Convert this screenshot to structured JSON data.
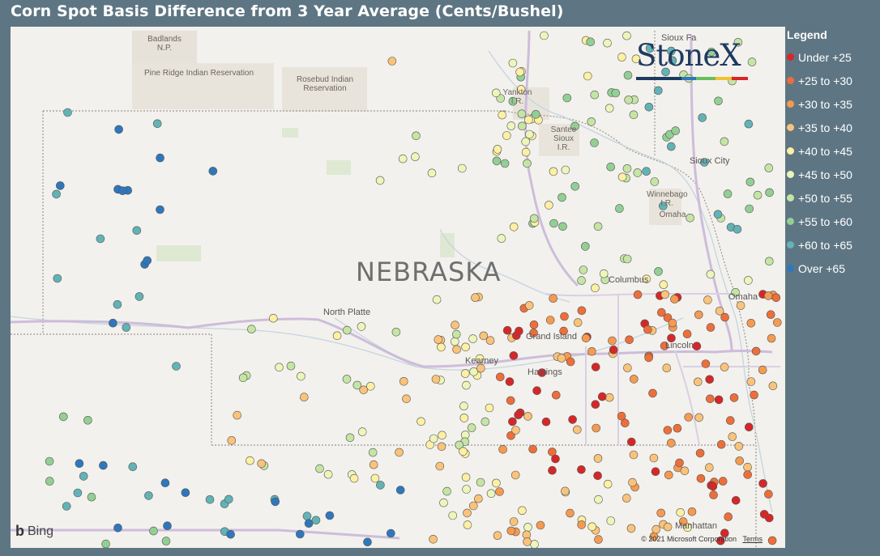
{
  "title": "Corn Spot Basis Difference from 3 Year Average (Cents/Bushel)",
  "legend": {
    "title": "Legend",
    "items": [
      {
        "label": "Under +25",
        "color": "#d62728"
      },
      {
        "label": "+25 to +30",
        "color": "#ee6e3a"
      },
      {
        "label": "+30 to +35",
        "color": "#f59a50"
      },
      {
        "label": "+35 to +40",
        "color": "#fac37a"
      },
      {
        "label": "+40 to +45",
        "color": "#fdf0a3"
      },
      {
        "label": "+45 to +50",
        "color": "#ecf6bb"
      },
      {
        "label": "+50 to +55",
        "color": "#c4e5a4"
      },
      {
        "label": "+55 to +60",
        "color": "#92cf94"
      },
      {
        "label": "+60 to +65",
        "color": "#62b3b6"
      },
      {
        "label": "Over +65",
        "color": "#2f77bd"
      }
    ]
  },
  "map": {
    "state_label": "NEBRASKA",
    "places": {
      "badlands": "Badlands\nN.P.",
      "pine_ridge": "Pine Ridge Indian Reservation",
      "rosebud": "Rosebud Indian\nReservation",
      "yankton": "Yankton\nI.R.",
      "santee": "Santee\nSioux\nI.R.",
      "winnebago": "Winnebago\nI.R.",
      "omaha_ir": "Omaha",
      "sioux_falls": "Sioux Fa",
      "sioux_city": "Sioux City",
      "columbus": "Columbus",
      "omaha": "Omaha",
      "north_platte": "North Platte",
      "grand_island": "Grand Island",
      "kearney": "Kearney",
      "hastings": "Hastings",
      "lincoln": "Lincoln",
      "manhattan": "Manhattan"
    }
  },
  "logo": {
    "text": "StoneX",
    "bar_colors": [
      "#1f3a5f",
      "#2f77bd",
      "#6bbf59",
      "#f2c12e",
      "#d62728"
    ]
  },
  "attribution": {
    "bing": "Bing",
    "copyright": "© 2021 Microsoft Corporation",
    "terms": "Terms"
  }
}
